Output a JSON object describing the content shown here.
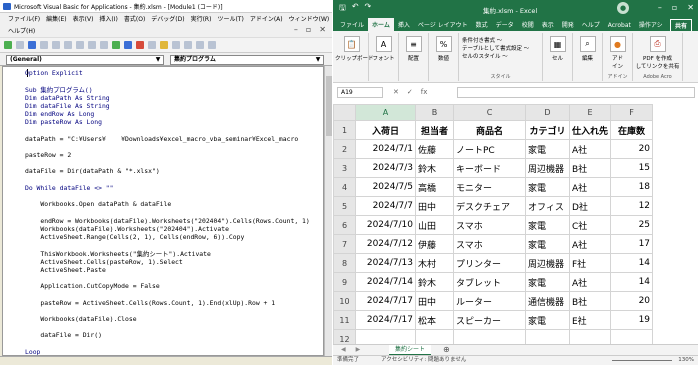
{
  "vbe": {
    "title": "Microsoft Visual Basic for Applications - 集約.xlsm - [Module1 (コード)]",
    "menu": [
      "ファイル(F)",
      "編集(E)",
      "表示(V)",
      "挿入(I)",
      "書式(O)",
      "デバッグ(D)",
      "実行(R)",
      "ツール(T)",
      "アドイン(A)",
      "ウィンドウ(W)"
    ],
    "help": "ヘルプ(H)",
    "combo_object": "(General)",
    "combo_proc": "集約プログラム",
    "code_lines": [
      "Option Explicit",
      "",
      "Sub 集約プログラム()",
      "Dim dataPath As String",
      "Dim dataFile As String",
      "Dim endRow As Long",
      "Dim pasteRow As Long",
      "",
      "dataPath = \"C:¥Users¥    ¥Downloads¥excel_macro_vba_seminar¥Excel_macro",
      "",
      "pasteRow = 2",
      "",
      "dataFile = Dir(dataPath & \"*.xlsx\")",
      "",
      "Do While dataFile <> \"\"",
      "",
      "    Workbooks.Open dataPath & dataFile",
      "",
      "    endRow = Workbooks(dataFile).Worksheets(\"202404\").Cells(Rows.Count, 1)",
      "    Workbooks(dataFile).Worksheets(\"202404\").Activate",
      "    ActiveSheet.Range(Cells(2, 1), Cells(endRow, 6)).Copy",
      "",
      "    ThisWorkbook.Worksheets(\"集約シート\").Activate",
      "    ActiveSheet.Cells(pasteRow, 1).Select",
      "    ActiveSheet.Paste",
      "",
      "    Application.CutCopyMode = False",
      "",
      "    pasteRow = ActiveSheet.Cells(Rows.Count, 1).End(xlUp).Row + 1",
      "",
      "    Workbooks(dataFile).Close",
      "",
      "    dataFile = Dir()",
      "",
      "Loop"
    ]
  },
  "excel": {
    "title": "集約.xlsm - Excel",
    "share_label": "共有",
    "tabs": [
      "ファイル",
      "ホーム",
      "挿入",
      "ページ レイアウト",
      "数式",
      "データ",
      "校閲",
      "表示",
      "開発",
      "ヘルプ",
      "Acrobat",
      "操作アシ"
    ],
    "ribbon_groups": [
      {
        "icon": "📋",
        "label": "クリップボード"
      },
      {
        "icon": "A",
        "label": "フォント"
      },
      {
        "icon": "≡",
        "label": "配置"
      },
      {
        "icon": "%",
        "label": "数値"
      },
      {
        "icon": "▦",
        "label": "セル"
      },
      {
        "icon": "⌕",
        "label": "編集"
      },
      {
        "icon": "●",
        "label": "アド\nイン"
      },
      {
        "icon": "⎙",
        "label": "PDF を作成\nしてリンクを共有"
      }
    ],
    "styles_items": [
      "条件付き書式 ～",
      "テーブルとして書式設定 ～",
      "セルのスタイル ～"
    ],
    "styles_label": "スタイル",
    "addin_label": "アドイン",
    "adobe_label": "Adobe Acro",
    "name_box": "A19",
    "fx_label": "fx",
    "columns": [
      "A",
      "B",
      "C",
      "D",
      "E",
      "F"
    ],
    "headers": [
      "入荷日",
      "担当者",
      "商品名",
      "カテゴリ",
      "仕入れ先",
      "在庫数"
    ],
    "rows": [
      [
        "2024/7/1",
        "佐藤",
        "ノートPC",
        "家電",
        "A社",
        "20"
      ],
      [
        "2024/7/3",
        "鈴木",
        "キーボード",
        "周辺機器",
        "B社",
        "15"
      ],
      [
        "2024/7/5",
        "高橋",
        "モニター",
        "家電",
        "A社",
        "18"
      ],
      [
        "2024/7/7",
        "田中",
        "デスクチェア",
        "オフィス",
        "D社",
        "12"
      ],
      [
        "2024/7/10",
        "山田",
        "スマホ",
        "家電",
        "C社",
        "25"
      ],
      [
        "2024/7/12",
        "伊藤",
        "スマホ",
        "家電",
        "A社",
        "17"
      ],
      [
        "2024/7/13",
        "木村",
        "プリンター",
        "周辺機器",
        "F社",
        "14"
      ],
      [
        "2024/7/14",
        "鈴木",
        "タブレット",
        "家電",
        "A社",
        "14"
      ],
      [
        "2024/7/17",
        "田中",
        "ルーター",
        "通信機器",
        "B社",
        "20"
      ],
      [
        "2024/7/17",
        "松本",
        "スピーカー",
        "家電",
        "E社",
        "19"
      ]
    ],
    "extra_rows": [
      "12",
      "13"
    ],
    "sheet_tab": "集約シート",
    "status_ready": "準備完了",
    "status_access": "アクセシビリティ: 問題ありません",
    "zoom": "130%"
  }
}
